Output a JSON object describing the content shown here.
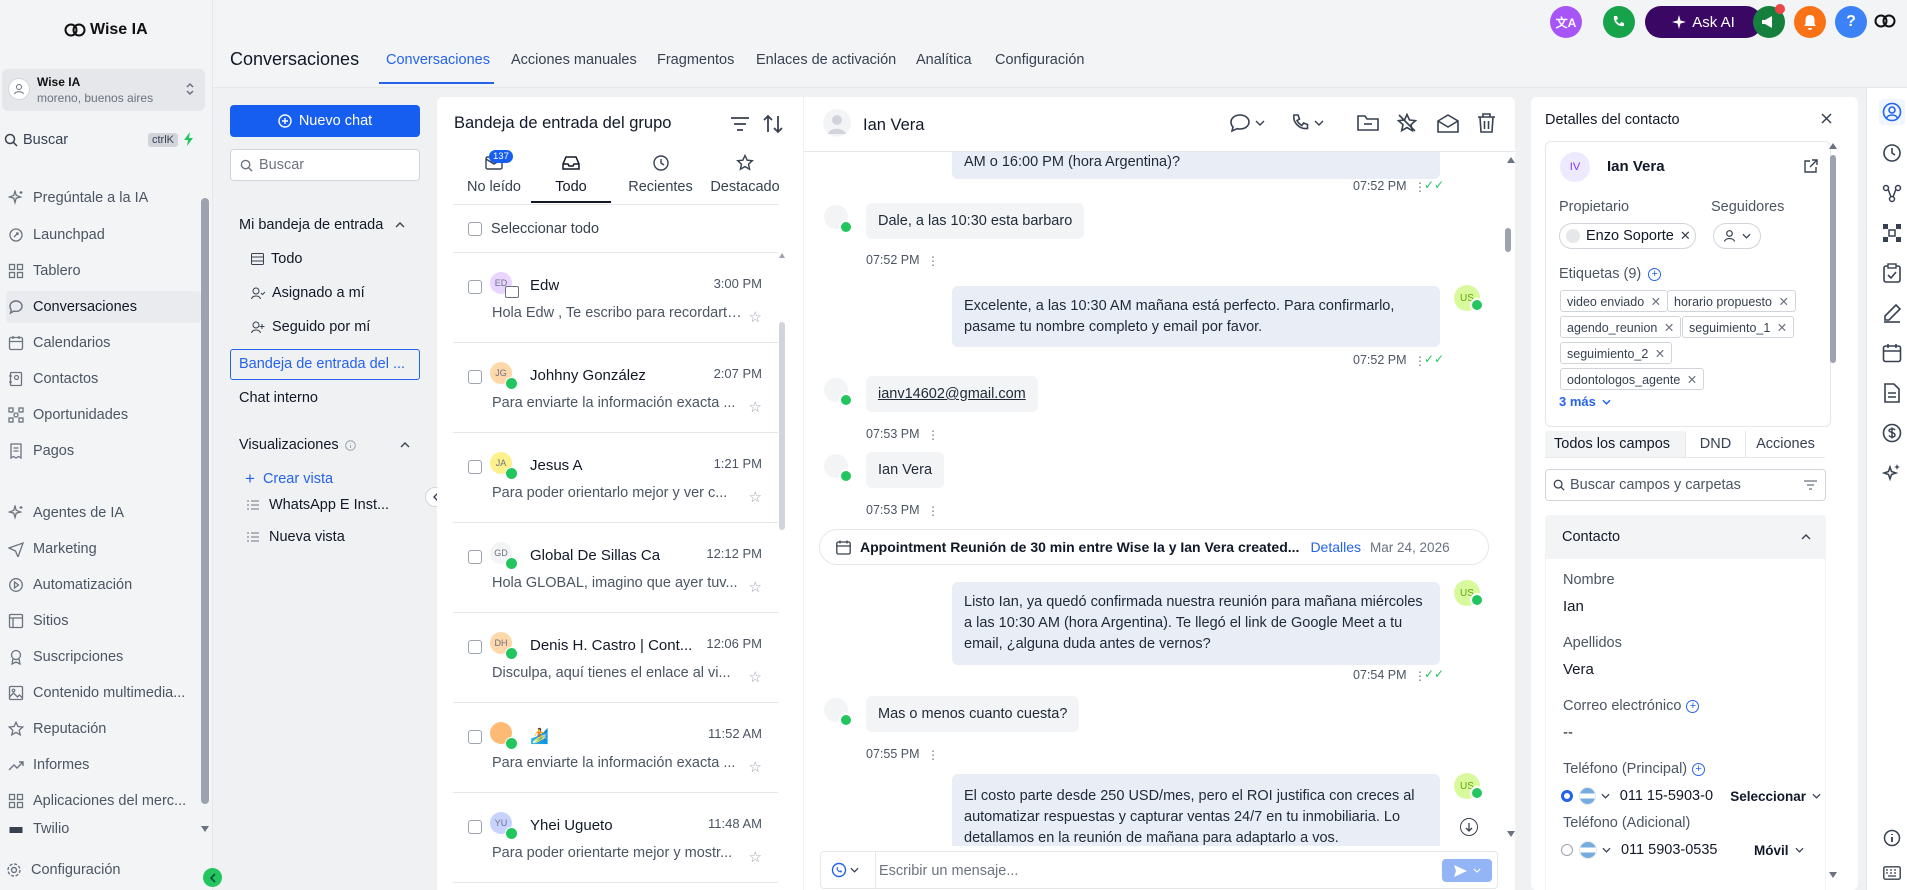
{
  "brand": {
    "name": "Wise IA"
  },
  "account": {
    "name": "Wise IA",
    "location": "moreno, buenos aires"
  },
  "search": {
    "label": "Buscar",
    "shortcut": "ctrlK"
  },
  "sidebar": {
    "items": [
      {
        "label": "Pregúntale a la IA",
        "icon": "sparkle-icon"
      },
      {
        "label": "Launchpad",
        "icon": "rocket-icon"
      },
      {
        "label": "Tablero",
        "icon": "grid-icon"
      },
      {
        "label": "Conversaciones",
        "icon": "chat-icon"
      },
      {
        "label": "Calendarios",
        "icon": "calendar-icon"
      },
      {
        "label": "Contactos",
        "icon": "contacts-icon"
      },
      {
        "label": "Oportunidades",
        "icon": "network-icon"
      },
      {
        "label": "Pagos",
        "icon": "receipt-icon"
      },
      {
        "label": "Agentes de IA",
        "icon": "sparkle-icon"
      },
      {
        "label": "Marketing",
        "icon": "send-icon"
      },
      {
        "label": "Automatización",
        "icon": "automation-icon"
      },
      {
        "label": "Sitios",
        "icon": "sites-icon"
      },
      {
        "label": "Suscripciones",
        "icon": "badge-icon"
      },
      {
        "label": "Contenido multimedia...",
        "icon": "image-icon"
      },
      {
        "label": "Reputación",
        "icon": "star-icon"
      },
      {
        "label": "Informes",
        "icon": "trend-icon"
      },
      {
        "label": "Aplicaciones del merc...",
        "icon": "apps-icon"
      },
      {
        "label": "Twilio",
        "icon": "twilio-icon"
      }
    ],
    "settings": "Configuración"
  },
  "header": {
    "title": "Conversaciones",
    "tabs": [
      "Conversaciones",
      "Acciones manuales",
      "Fragmentos",
      "Enlaces de activación",
      "Analítica",
      "Configuración"
    ],
    "ask_ai": "Ask AI",
    "help": "?"
  },
  "inbox_nav": {
    "new_chat": "Nuevo chat",
    "search_placeholder": "Buscar",
    "my_inbox": "Mi bandeja de entrada",
    "items": [
      "Todo",
      "Asignado a mí",
      "Seguido por mí"
    ],
    "group_inbox": "Bandeja de entrada del ...",
    "internal_chat": "Chat interno",
    "views_title": "Visualizaciones",
    "create_view": "Crear vista",
    "views": [
      "WhatsApp E Inst...",
      "Nueva vista"
    ]
  },
  "conv_list": {
    "title": "Bandeja de entrada del grupo",
    "tabs": [
      "No leído",
      "Todo",
      "Recientes",
      "Destacado"
    ],
    "unread_count": "137",
    "select_all": "Seleccionar todo",
    "items": [
      {
        "initials": "ED",
        "name": "Edw",
        "time": "3:00 PM",
        "preview": "Hola Edw , Te escribo para recordarte...",
        "color": "#e9d5ff"
      },
      {
        "initials": "JG",
        "name": "Johhny González",
        "time": "2:07 PM",
        "preview": "Para enviarte la información exacta ...",
        "color": "#fed7aa"
      },
      {
        "initials": "JA",
        "name": "Jesus A",
        "time": "1:21 PM",
        "preview": "Para poder orientarlo mejor y ver c...",
        "color": "#fef08a"
      },
      {
        "initials": "GD",
        "name": "Global De Sillas Ca",
        "time": "12:12 PM",
        "preview": "Hola GLOBAL, imagino que ayer tuv...",
        "color": "#f3f4f6"
      },
      {
        "initials": "DH",
        "name": "Denis H. Castro | Cont...",
        "time": "12:06 PM",
        "preview": "Disculpa, aquí tienes el enlace al vi...",
        "color": "#fed7aa"
      },
      {
        "initials": "",
        "name": "🏄",
        "time": "11:52 AM",
        "preview": "Para enviarte la información exacta ...",
        "color": "#fdba74"
      },
      {
        "initials": "YU",
        "name": "Yhei Ugueto",
        "time": "11:48 AM",
        "preview": "Para poder orientarte mejor y mostr...",
        "color": "#c7d2fe"
      }
    ]
  },
  "chat": {
    "contact_name": "Ian Vera",
    "messages": [
      {
        "dir": "out",
        "text": "AM o 16:00 PM (hora Argentina)?",
        "time": "07:52 PM"
      },
      {
        "dir": "in",
        "text": "Dale, a las 10:30 esta barbaro",
        "time": "07:52 PM"
      },
      {
        "dir": "out",
        "text": "Excelente, a las 10:30 AM mañana está perfecto. Para confirmarlo, pasame tu nombre completo y email por favor.",
        "time": "07:52 PM"
      },
      {
        "dir": "in",
        "text": "ianv14602@gmail.com",
        "time": "07:53 PM"
      },
      {
        "dir": "in",
        "text": "Ian Vera",
        "time": "07:53 PM"
      },
      {
        "dir": "out",
        "text": "Listo Ian, ya quedó confirmada nuestra reunión para mañana miércoles a las 10:30 AM (hora Argentina). Te llegó el link de Google Meet a tu email, ¿alguna duda antes de vernos?",
        "time": "07:54 PM"
      },
      {
        "dir": "in",
        "text": "Mas o menos cuanto cuesta?",
        "time": "07:55 PM"
      },
      {
        "dir": "out",
        "text": "El costo parte desde 250 USD/mes, pero el ROI justifica con creces al automatizar respuestas y capturar ventas 24/7 en tu inmobiliaria. Lo detallamos en la reunión de mañana para adaptarlo a vos.",
        "time": ""
      }
    ],
    "appointment": {
      "text": "Appointment Reunión de 30 min entre Wise Ia y Ian Vera created...",
      "link": "Detalles",
      "date": "Mar 24, 2026"
    },
    "composer_placeholder": "Escribir un mensaje...",
    "user_initials": "US"
  },
  "contact": {
    "panel_title": "Detalles del contacto",
    "initials": "IV",
    "name": "Ian Vera",
    "owner_label": "Propietario",
    "owner": "Enzo Soporte",
    "followers_label": "Seguidores",
    "tags_label": "Etiquetas (9)",
    "tags": [
      "video enviado",
      "horario propuesto",
      "agendo_reunion",
      "seguimiento_1",
      "seguimiento_2",
      "odontologos_agente"
    ],
    "more": "3 más",
    "tabs": [
      "Todos los campos",
      "DND",
      "Acciones"
    ],
    "search_placeholder": "Buscar campos y carpetas",
    "section": "Contacto",
    "fields": {
      "first_name_label": "Nombre",
      "first_name": "Ian",
      "last_name_label": "Apellidos",
      "last_name": "Vera",
      "email_label": "Correo electrónico",
      "email": "--",
      "phone_label": "Teléfono (Principal)",
      "phone": "011 15-5903-0",
      "phone_type": "Seleccionar",
      "phone2_label": "Teléfono (Adicional)",
      "phone2": "011 5903-0535",
      "phone2_type": "Móvil"
    }
  },
  "colors": {
    "accent": "#2563eb",
    "whatsapp": "#22c55e",
    "ask_ai_bg": "#4c1d95",
    "bubble_out": "#e8edf6"
  }
}
